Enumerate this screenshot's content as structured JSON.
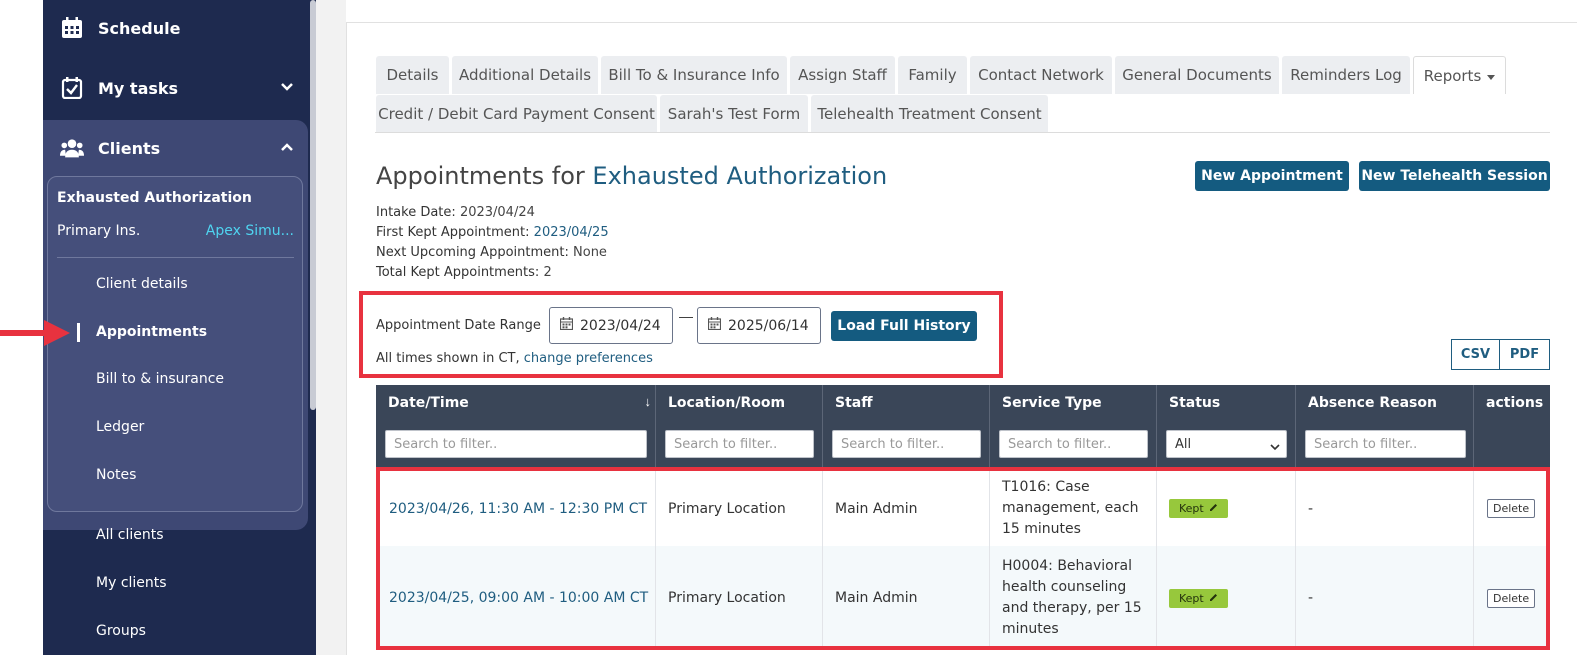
{
  "sidebar": {
    "schedule": "Schedule",
    "my_tasks": "My tasks",
    "clients": "Clients",
    "client_name": "Exhausted Authorization",
    "primary_ins_label": "Primary Ins.",
    "primary_ins_value": "Apex Simu...",
    "client_links": [
      "Client details",
      "Appointments",
      "Bill to & insurance",
      "Ledger",
      "Notes"
    ],
    "other_links": [
      "All clients",
      "My clients",
      "Groups"
    ]
  },
  "tabs": {
    "row1": [
      "Details",
      "Additional Details",
      "Bill To & Insurance Info",
      "Assign Staff",
      "Family",
      "Contact Network",
      "General Documents",
      "Reminders Log",
      "Reports"
    ],
    "row2": [
      "Credit / Debit Card Payment Consent",
      "Sarah's Test Form",
      "Telehealth Treatment Consent"
    ]
  },
  "heading": {
    "prefix": "Appointments for",
    "client": "Exhausted Authorization"
  },
  "buttons": {
    "new_appointment": "New Appointment",
    "new_telehealth": "New Telehealth Session",
    "load_full_history": "Load Full History",
    "csv": "CSV",
    "pdf": "PDF"
  },
  "meta": {
    "intake_label": "Intake Date:",
    "intake_value": "2023/04/24",
    "first_kept_label": "First Kept Appointment:",
    "first_kept_value": "2023/04/25",
    "next_label": "Next Upcoming Appointment:",
    "next_value": "None",
    "total_label": "Total Kept Appointments:",
    "total_value": "2"
  },
  "range": {
    "label": "Appointment Date Range",
    "start": "2023/04/24",
    "end": "2025/06/14",
    "times_prefix": "All times shown in CT,",
    "change_prefs": "change preferences"
  },
  "table": {
    "headers": [
      "Date/Time",
      "Location/Room",
      "Staff",
      "Service Type",
      "Status",
      "Absence Reason",
      "actions"
    ],
    "filter_placeholder": "Search to filter..",
    "status_filter": "All",
    "rows": [
      {
        "datetime": "2023/04/26, 11:30 AM - 12:30 PM CT",
        "location": "Primary Location",
        "staff": "Main Admin",
        "service": "T1016: Case management, each 15 minutes",
        "status": "Kept",
        "absence": "-",
        "action": "Delete"
      },
      {
        "datetime": "2023/04/25, 09:00 AM - 10:00 AM CT",
        "location": "Primary Location",
        "staff": "Main Admin",
        "service": "H0004: Behavioral health counseling and therapy, per 15 minutes",
        "status": "Kept",
        "absence": "-",
        "action": "Delete"
      }
    ]
  },
  "colors": {
    "sidebar": "#1e2a4f",
    "accent": "#145b80",
    "highlight": "#e8323f",
    "badge": "#97c83c"
  }
}
